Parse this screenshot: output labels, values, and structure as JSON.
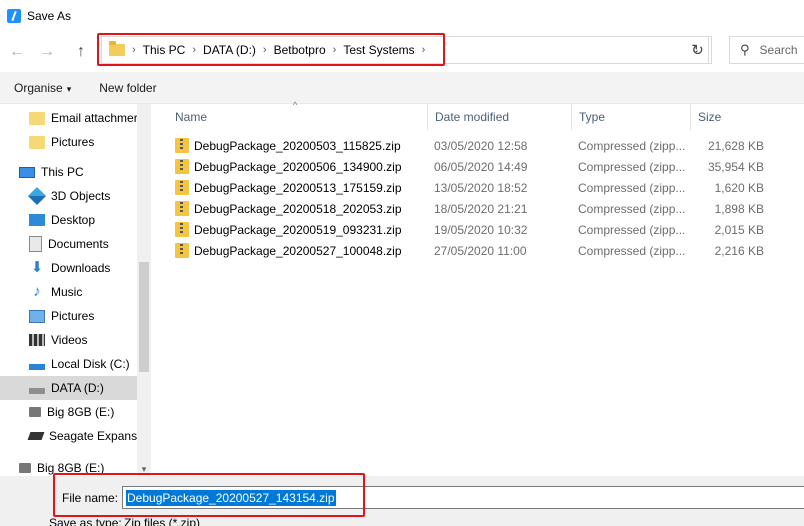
{
  "window": {
    "title": "Save As"
  },
  "nav": {
    "back": "←",
    "forward": "→",
    "up": "↑",
    "refresh": "↻",
    "dropdown": "⌄"
  },
  "address": {
    "crumbs": [
      "This PC",
      "DATA (D:)",
      "Betbotpro",
      "Test Systems"
    ],
    "separator": "›"
  },
  "search": {
    "placeholder": "Search"
  },
  "toolbar": {
    "organise": "Organise",
    "organise_caret": "▾",
    "new_folder": "New folder"
  },
  "sidebar": {
    "items": [
      {
        "label": "Email attachmer",
        "icon": "folder-icon"
      },
      {
        "label": "Pictures",
        "icon": "folder-icon"
      },
      {
        "label": "This PC",
        "icon": "computer-icon"
      },
      {
        "label": "3D Objects",
        "icon": "cube-icon"
      },
      {
        "label": "Desktop",
        "icon": "desktop-icon"
      },
      {
        "label": "Documents",
        "icon": "documents-icon"
      },
      {
        "label": "Downloads",
        "icon": "download-arrow-icon"
      },
      {
        "label": "Music",
        "icon": "music-note-icon"
      },
      {
        "label": "Pictures",
        "icon": "pictures-icon"
      },
      {
        "label": "Videos",
        "icon": "film-icon"
      },
      {
        "label": "Local Disk (C:)",
        "icon": "windows-drive-icon"
      },
      {
        "label": "DATA (D:)",
        "icon": "drive-icon"
      },
      {
        "label": "Big 8GB (E:)",
        "icon": "usb-drive-icon"
      },
      {
        "label": "Seagate Expansio",
        "icon": "external-drive-icon"
      },
      {
        "label": "Big 8GB (E:)",
        "icon": "usb-drive-icon"
      }
    ],
    "scroll_down_arrow": "▾"
  },
  "filelist": {
    "columns": {
      "name": "Name",
      "date": "Date modified",
      "type": "Type",
      "size": "Size"
    },
    "sort_indicator": "^",
    "rows": [
      {
        "name": "DebugPackage_20200503_115825.zip",
        "date": "03/05/2020 12:58",
        "type": "Compressed (zipp...",
        "size": "21,628 KB"
      },
      {
        "name": "DebugPackage_20200506_134900.zip",
        "date": "06/05/2020 14:49",
        "type": "Compressed (zipp...",
        "size": "35,954 KB"
      },
      {
        "name": "DebugPackage_20200513_175159.zip",
        "date": "13/05/2020 18:52",
        "type": "Compressed (zipp...",
        "size": "1,620 KB"
      },
      {
        "name": "DebugPackage_20200518_202053.zip",
        "date": "18/05/2020 21:21",
        "type": "Compressed (zipp...",
        "size": "1,898 KB"
      },
      {
        "name": "DebugPackage_20200519_093231.zip",
        "date": "19/05/2020 10:32",
        "type": "Compressed (zipp...",
        "size": "2,015 KB"
      },
      {
        "name": "DebugPackage_20200527_100048.zip",
        "date": "27/05/2020 11:00",
        "type": "Compressed (zipp...",
        "size": "2,216 KB"
      }
    ]
  },
  "bottom": {
    "file_name_label": "File name:",
    "file_name_value": "DebugPackage_20200527_143154.zip",
    "save_type_label": "Save as type:",
    "save_type_value": "Zip files (*.zip)"
  },
  "colors": {
    "highlight_red": "#e0151a",
    "selection_blue": "#0078d7",
    "folder_yellow": "#f8d775"
  }
}
